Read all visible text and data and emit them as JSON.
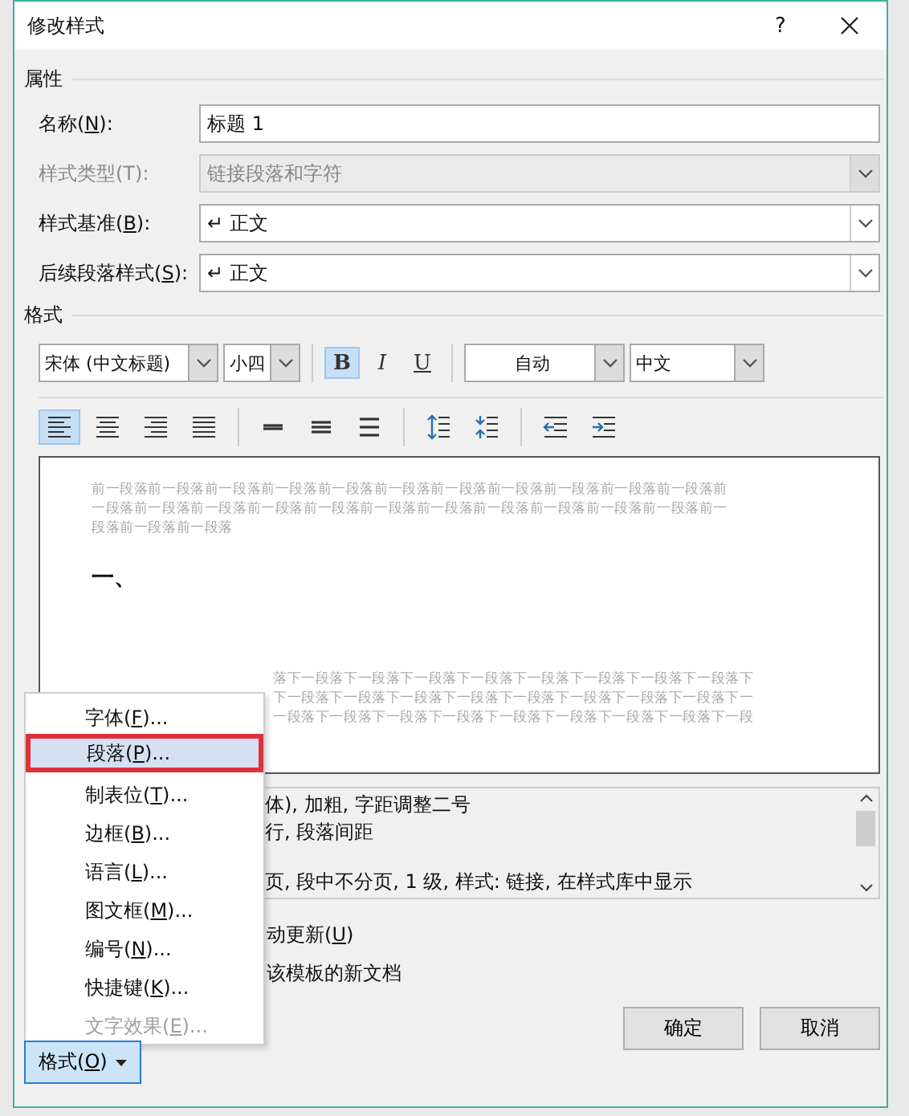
{
  "window": {
    "title": "修改样式",
    "help": "?"
  },
  "properties": {
    "heading": "属性",
    "rows": [
      {
        "kind": "text",
        "label": "名称(",
        "key": "N",
        "after": "):",
        "value": "标题 1",
        "disabled": false
      },
      {
        "kind": "combo",
        "label": "样式类型(T):",
        "value": "链接段落和字符",
        "disabled": true
      },
      {
        "kind": "combo",
        "label": "样式基准(",
        "key": "B",
        "after": "):",
        "value": "↵ 正文",
        "disabled": false
      },
      {
        "kind": "combo",
        "label": "后续段落样式(",
        "key": "S",
        "after": "):",
        "value": "↵ 正文",
        "disabled": false
      }
    ]
  },
  "format": {
    "heading": "格式",
    "font": "宋体 (中文标题)",
    "size": "小四",
    "styles": [
      {
        "kind": "bold",
        "label": "B",
        "selected": true
      },
      {
        "kind": "italic",
        "label": "I",
        "selected": false
      },
      {
        "kind": "underline",
        "label": "U",
        "selected": false
      }
    ],
    "color_setting": "自动",
    "language": "中文",
    "paragraph_buttons": [
      {
        "kind": "align-left",
        "selected": true
      },
      {
        "kind": "align-center",
        "selected": false
      },
      {
        "kind": "align-right",
        "selected": false
      },
      {
        "kind": "justify",
        "selected": false
      },
      {
        "kind": "sep"
      },
      {
        "kind": "single",
        "selected": false
      },
      {
        "kind": "onehalf",
        "selected": false
      },
      {
        "kind": "double",
        "selected": false
      },
      {
        "kind": "sep"
      },
      {
        "kind": "space-more",
        "selected": false
      },
      {
        "kind": "space-less",
        "selected": false
      },
      {
        "kind": "sep"
      },
      {
        "kind": "outdent",
        "selected": false
      },
      {
        "kind": "indent",
        "selected": false
      }
    ]
  },
  "preview": {
    "previous_lines": [
      "前一段落前一段落前一段落前一段落前一段落前一段落前一段落前一段落前一段落前一段落前一段落前",
      "一段落前一段落前一段落前一段落前一段落前一段落前一段落前一段落前一段落前一段落前一段落前一",
      "段落前一段落前一段落"
    ],
    "sample": "一、",
    "following_lines": [
      "落下一段落下一段落下一段落下一段落下一段落下一段落下一段落下一段落下",
      "下一段落下一段落下一段落下一段落下一段落下一段落下一段落下一段落下一",
      "一段落下一段落下一段落下一段落下一段落下一段落下一段落下一段落下一段"
    ]
  },
  "description": {
    "paragraphs": [
      [
        "体), 加粗, 字距调整二号",
        "行, 段落间距"
      ],
      [
        "页, 段中不分页, 1 级, 样式: 链接, 在样式库中显示"
      ]
    ]
  },
  "options": [
    {
      "label": "动更新(",
      "key": "U",
      "after": ")"
    },
    {
      "label": "该模板的新文档"
    }
  ],
  "format_menu": {
    "items": [
      {
        "label": "字体(",
        "key": "F",
        "after": ")...",
        "selected": false,
        "disabled": false
      },
      {
        "label": "段落(",
        "key": "P",
        "after": ")...",
        "selected": true,
        "disabled": false
      },
      {
        "label": "制表位(",
        "key": "T",
        "after": ")...",
        "selected": false,
        "disabled": false
      },
      {
        "label": "边框(",
        "key": "B",
        "after": ")...",
        "selected": false,
        "disabled": false
      },
      {
        "label": "语言(",
        "key": "L",
        "after": ")...",
        "selected": false,
        "disabled": false
      },
      {
        "label": "图文框(",
        "key": "M",
        "after": ")...",
        "selected": false,
        "disabled": false
      },
      {
        "label": "编号(",
        "key": "N",
        "after": ")...",
        "selected": false,
        "disabled": false
      },
      {
        "label": "快捷键(",
        "key": "K",
        "after": ")...",
        "selected": false,
        "disabled": false
      },
      {
        "label": "文字效果(",
        "key": "E",
        "after": ")...",
        "selected": false,
        "disabled": true
      }
    ]
  },
  "format_button": {
    "label": "格式(",
    "key": "O",
    "after": ")",
    "selected": true
  },
  "buttons": [
    "确定",
    "取消"
  ]
}
